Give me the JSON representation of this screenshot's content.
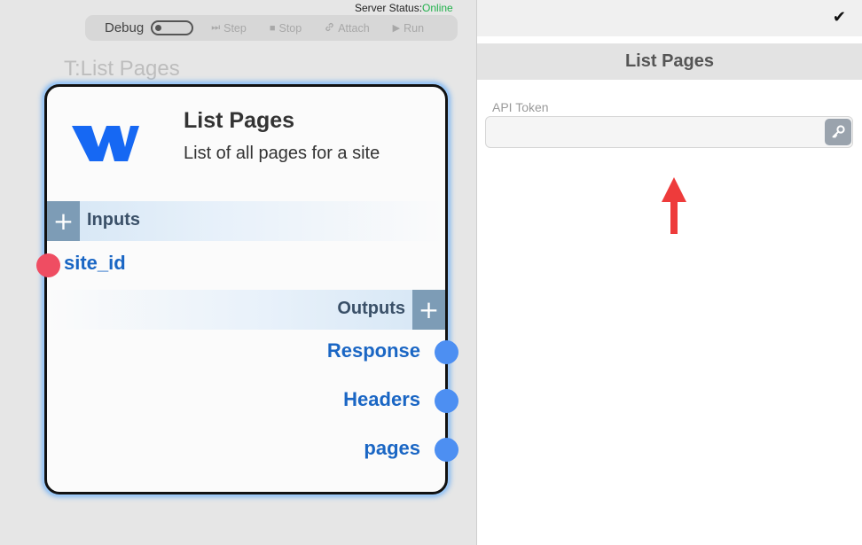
{
  "server_status": {
    "label": "Server Status:",
    "value": "Online",
    "color": "#22b14c"
  },
  "debug_bar": {
    "label": "Debug",
    "toggle_on": false,
    "buttons": [
      {
        "icon": "step-icon",
        "glyph": "⏭",
        "label": "Step"
      },
      {
        "icon": "stop-icon",
        "glyph": "■",
        "label": "Stop"
      },
      {
        "icon": "attach-icon",
        "glyph": "🔗",
        "label": "Attach"
      },
      {
        "icon": "run-icon",
        "glyph": "▶",
        "label": "Run"
      }
    ]
  },
  "canvas_label": "T:List Pages",
  "node": {
    "title": "List Pages",
    "description": "List of all pages for a site",
    "logo": "webflow-logo",
    "inputs_label": "Inputs",
    "outputs_label": "Outputs",
    "inputs": [
      {
        "name": "site_id",
        "color": "#ef4d62"
      }
    ],
    "outputs": [
      {
        "name": "Response",
        "color": "#4d8ff2"
      },
      {
        "name": "Headers",
        "color": "#4d8ff2"
      },
      {
        "name": "pages",
        "color": "#4d8ff2"
      }
    ]
  },
  "panel": {
    "check_icon": "check-icon",
    "title": "List Pages",
    "api_token_label": "API Token",
    "api_token_value": "",
    "key_icon": "key-icon",
    "annotation": "red-arrow-up"
  }
}
